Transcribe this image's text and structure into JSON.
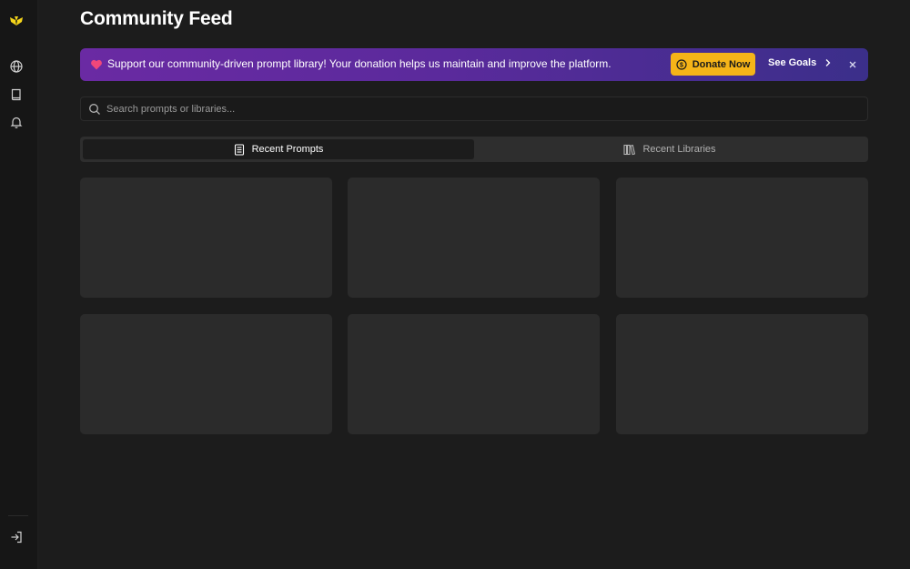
{
  "page": {
    "title": "Community Feed"
  },
  "sidebar": {
    "items": [
      {
        "icon": "logo-icon",
        "label": ""
      },
      {
        "icon": "globe-icon",
        "label": ""
      },
      {
        "icon": "book-icon",
        "label": ""
      },
      {
        "icon": "bell-icon",
        "label": ""
      }
    ],
    "footer_icon": "logout-icon"
  },
  "banner": {
    "message": "Support our community-driven prompt library! Your donation helps us maintain and improve the platform.",
    "donate_label": "Donate Now",
    "goals_label": "See Goals",
    "heart_color": "#f0477a",
    "donate_color": "#f5b418"
  },
  "search": {
    "value": "",
    "placeholder": "Search prompts or libraries..."
  },
  "tabs": [
    {
      "label": "Recent Prompts",
      "icon": "document-icon",
      "active": true
    },
    {
      "label": "Recent Libraries",
      "icon": "library-icon",
      "active": false
    }
  ],
  "cards": {
    "count": 6,
    "state": "loading"
  },
  "colors": {
    "background": "#1c1c1c",
    "accent": "#f5d51a",
    "card": "#2b2b2b"
  }
}
